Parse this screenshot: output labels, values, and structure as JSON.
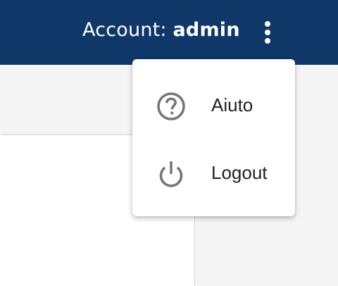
{
  "header": {
    "account_prefix": "Account: ",
    "account_user": "admin",
    "more_icon": "more-vert-icon"
  },
  "menu": {
    "items": [
      {
        "label": "Aiuto",
        "icon": "help-circle-icon"
      },
      {
        "label": "Logout",
        "icon": "power-icon"
      }
    ]
  },
  "colors": {
    "header_background": "#0f3869",
    "header_text": "#ffffff",
    "menu_background": "#ffffff",
    "menu_text": "#212121",
    "menu_icon": "#757575",
    "page_background": "#f5f5f5"
  }
}
